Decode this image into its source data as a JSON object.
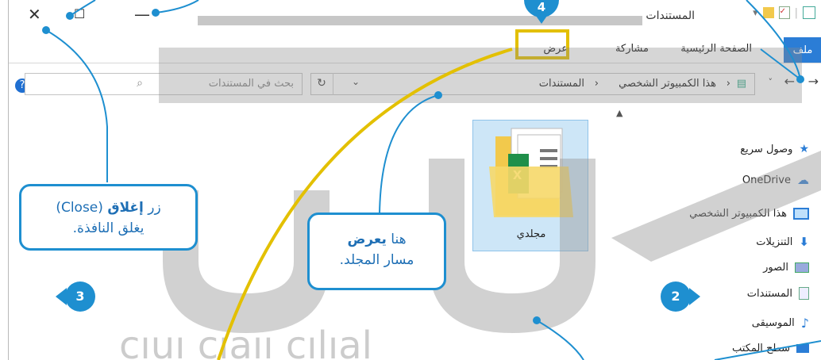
{
  "window": {
    "title": "المستندات",
    "controls": {
      "close": "✕",
      "maximize": "☐",
      "minimize": "—"
    }
  },
  "ribbon": {
    "tabs": {
      "file": "ملف",
      "home": "الصفحة الرئيسية",
      "share": "مشاركة",
      "view": "عرض"
    }
  },
  "address": {
    "segments": [
      "هذا الكمبيوتر الشخصي",
      "المستندات"
    ],
    "separator": "›"
  },
  "search": {
    "placeholder": "بحث في المستندات"
  },
  "nav": {
    "items": [
      {
        "label": "وصول سريع",
        "icon": "star-icon"
      },
      {
        "label": "OneDrive",
        "icon": "cloud-icon"
      },
      {
        "label": "هذا الكمبيوتر الشخصي",
        "icon": "computer-icon"
      },
      {
        "label": "التنزيلات",
        "icon": "download-icon"
      },
      {
        "label": "الصور",
        "icon": "pictures-icon"
      },
      {
        "label": "المستندات",
        "icon": "documents-icon"
      },
      {
        "label": "الموسيقى",
        "icon": "music-icon"
      },
      {
        "label": "سطح المكتب",
        "icon": "desktop-icon"
      }
    ]
  },
  "content": {
    "folder_label": "مجلدي"
  },
  "callouts": {
    "close_line1_pre": "زر ",
    "close_line1_bold": "إغلاق",
    "close_line1_post": " (Close)",
    "close_line2": "يغلق النافذة.",
    "path_line1_pre": "هنا ",
    "path_line1_bold": "يعرض",
    "path_line2": "مسار المجلد."
  },
  "badges": {
    "b2": "2",
    "b3": "3",
    "b4": "4"
  },
  "colors": {
    "accent": "#1e8fd0",
    "highlight": "#e3c000",
    "file_tab": "#2b7dd6",
    "selected": "#cde6f7"
  }
}
